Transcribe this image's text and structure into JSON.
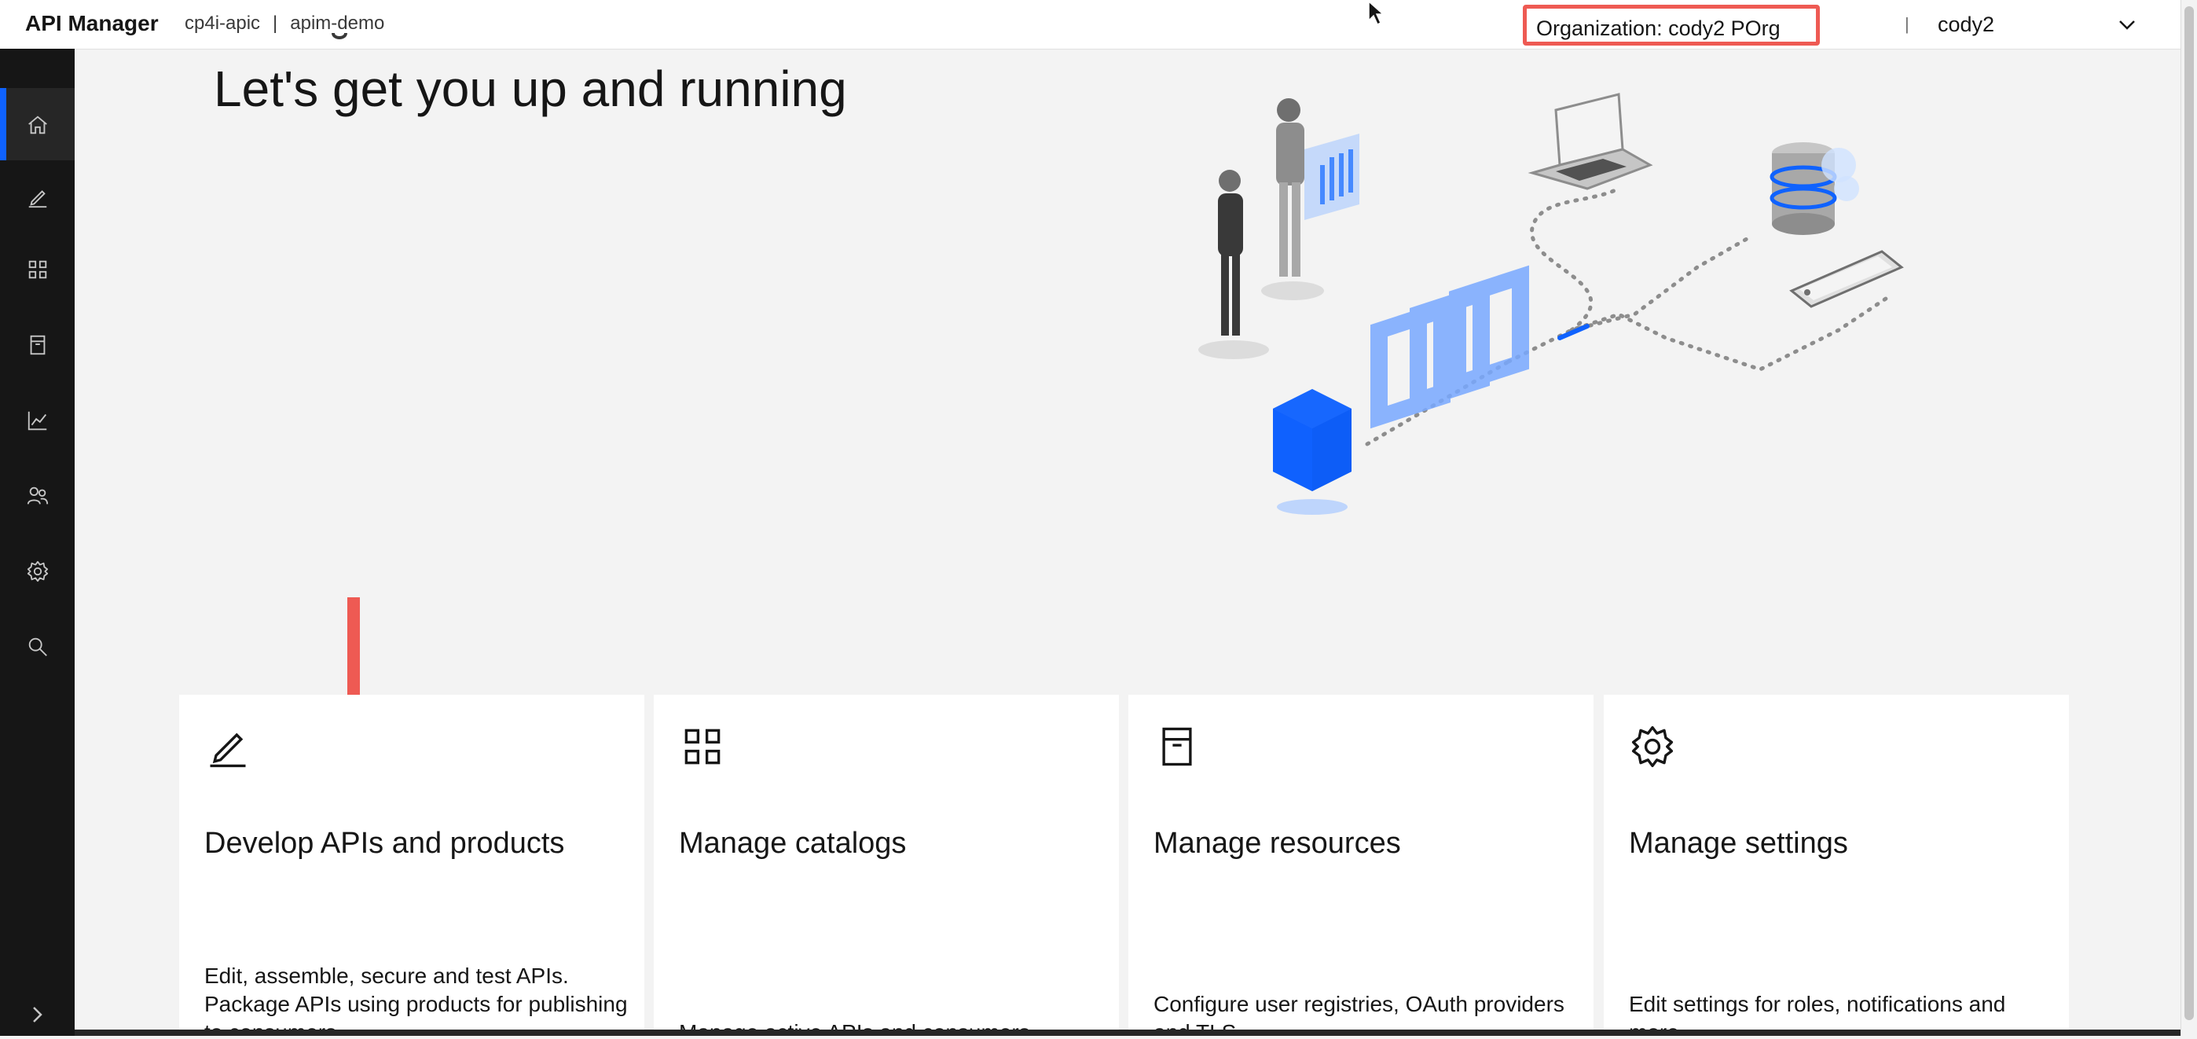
{
  "header": {
    "app_name": "API Manager",
    "crumbs": [
      "cp4i-apic",
      "apim-demo"
    ],
    "crumb_separator": "|",
    "organization_label": "Organization:  cody2 POrg",
    "separator": "|",
    "user_name": "cody2"
  },
  "sidebar": {
    "items": [
      {
        "icon": "home-icon",
        "active": true
      },
      {
        "icon": "pencil-icon"
      },
      {
        "icon": "grid-icon"
      },
      {
        "icon": "archive-icon"
      },
      {
        "icon": "line-chart-icon"
      },
      {
        "icon": "users-icon"
      },
      {
        "icon": "gear-icon"
      },
      {
        "icon": "search-icon"
      }
    ],
    "expand_icon": "chevron-right-icon"
  },
  "hero": {
    "title": "Let's get you up and running"
  },
  "cards": [
    {
      "icon": "pencil-icon",
      "title": "Develop APIs and products",
      "description": "Edit, assemble, secure and test APIs. Package APIs using products for publishing to consumers."
    },
    {
      "icon": "grid-icon",
      "title": "Manage catalogs",
      "description": "Manage active APIs and consumers"
    },
    {
      "icon": "archive-icon",
      "title": "Manage resources",
      "description": "Configure user registries, OAuth providers and TLS"
    },
    {
      "icon": "gear-icon",
      "title": "Manage settings",
      "description": "Edit settings for roles, notifications and more"
    }
  ],
  "colors": {
    "accent": "#0f62fe",
    "annotation": "#ee5a53",
    "sidebar_bg": "#161616",
    "page_bg": "#f3f3f3"
  }
}
